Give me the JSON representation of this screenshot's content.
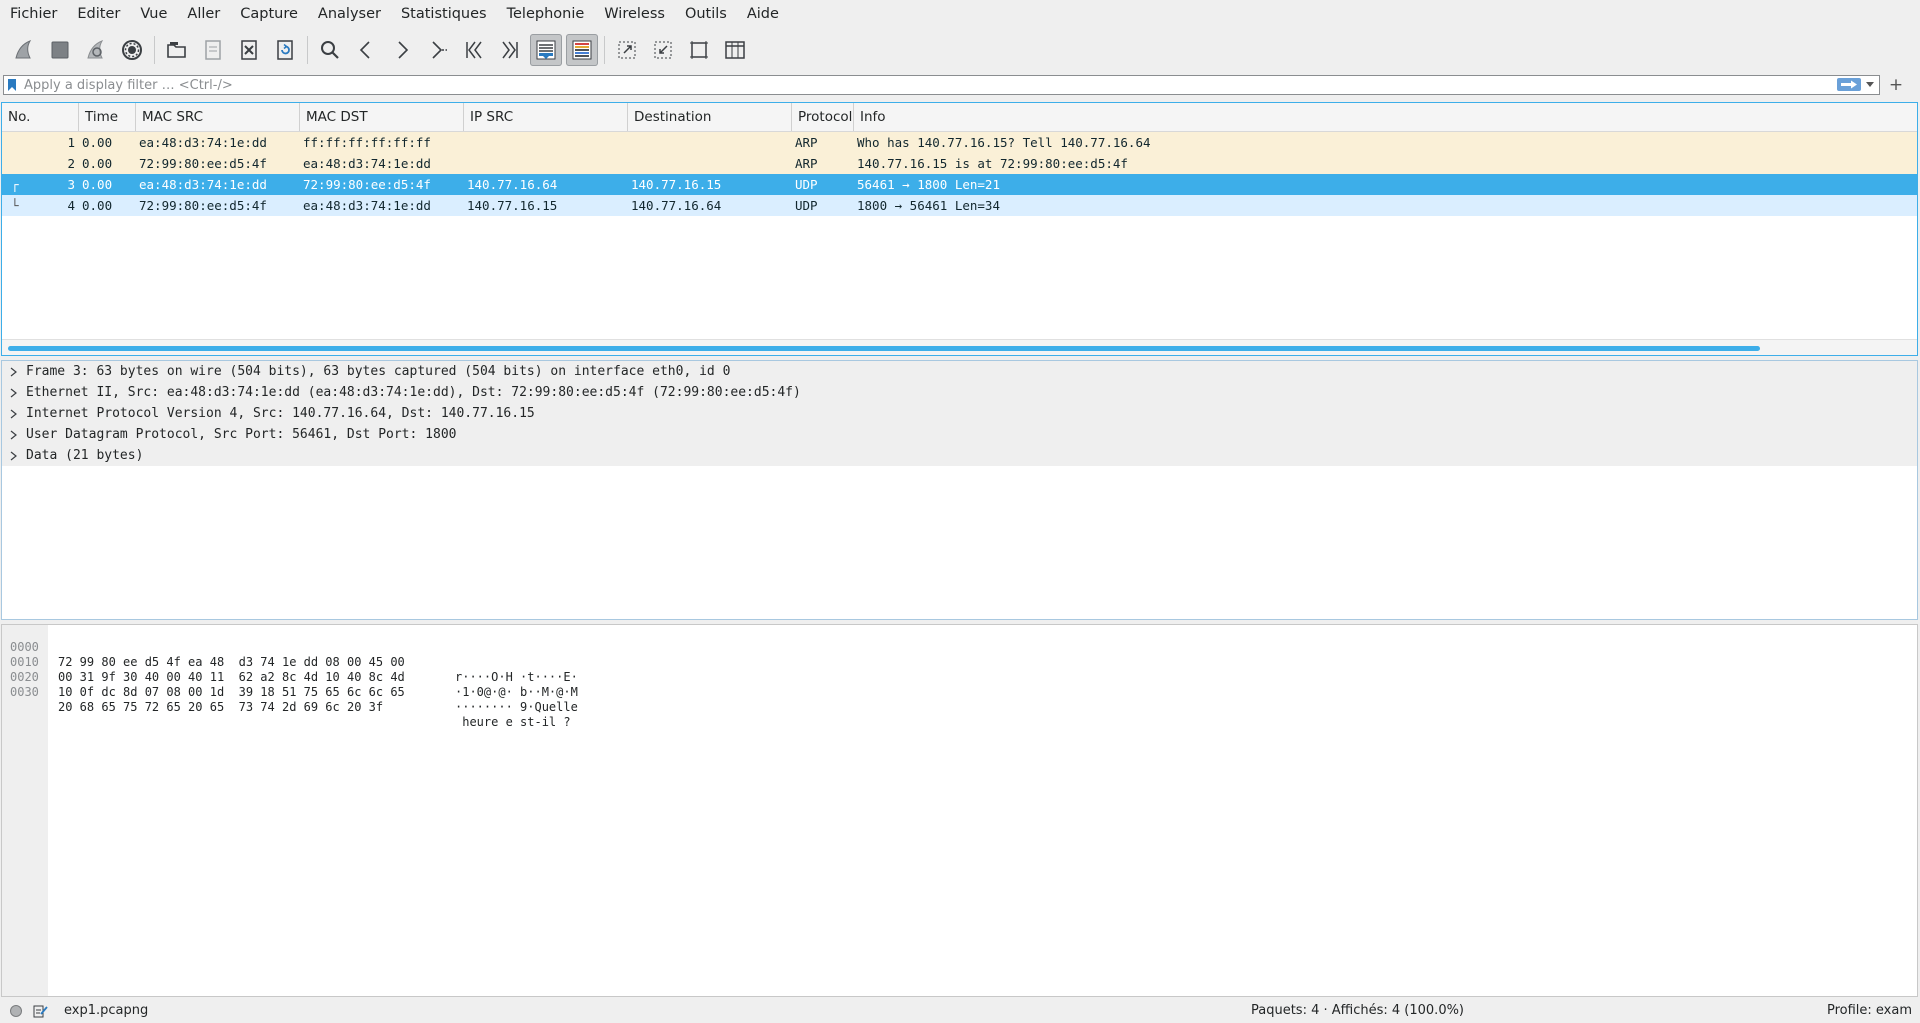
{
  "menu": [
    "Fichier",
    "Editer",
    "Vue",
    "Aller",
    "Capture",
    "Analyser",
    "Statistiques",
    "Telephonie",
    "Wireless",
    "Outils",
    "Aide"
  ],
  "toolbar": {
    "icons": [
      "shark-fin-start-icon",
      "stop-icon",
      "restart-icon",
      "capture-options-icon",
      "open-folder-icon",
      "save-icon",
      "close-file-icon",
      "reload-icon",
      "find-icon",
      "go-back-icon",
      "go-forward-icon",
      "go-to-packet-icon",
      "first-packet-icon",
      "last-packet-icon",
      "autoscroll-icon",
      "colorize-icon",
      "zoom-in-icon",
      "zoom-out-icon",
      "normal-size-icon",
      "resize-columns-icon"
    ]
  },
  "filter": {
    "placeholder": "Apply a display filter … <Ctrl-/>",
    "value": "",
    "add_label": "+"
  },
  "packet_list": {
    "columns": [
      "No.",
      "Time",
      "MAC SRC",
      "MAC DST",
      "IP SRC",
      "Destination",
      "Protocol",
      "Info"
    ],
    "rows": [
      {
        "no": "1",
        "time": "0.00",
        "mac_src": "ea:48:d3:74:1e:dd",
        "mac_dst": "ff:ff:ff:ff:ff:ff",
        "ip_src": "",
        "dst": "",
        "proto": "ARP",
        "info": "Who has 140.77.16.15? Tell 140.77.16.64"
      },
      {
        "no": "2",
        "time": "0.00",
        "mac_src": "72:99:80:ee:d5:4f",
        "mac_dst": "ea:48:d3:74:1e:dd",
        "ip_src": "",
        "dst": "",
        "proto": "ARP",
        "info": "140.77.16.15 is at 72:99:80:ee:d5:4f"
      },
      {
        "no": "3",
        "time": "0.00",
        "mac_src": "ea:48:d3:74:1e:dd",
        "mac_dst": "72:99:80:ee:d5:4f",
        "ip_src": "140.77.16.64",
        "dst": "140.77.16.15",
        "proto": "UDP",
        "info": "56461 → 1800 Len=21"
      },
      {
        "no": "4",
        "time": "0.00",
        "mac_src": "72:99:80:ee:d5:4f",
        "mac_dst": "ea:48:d3:74:1e:dd",
        "ip_src": "140.77.16.15",
        "dst": "140.77.16.64",
        "proto": "UDP",
        "info": "1800 → 56461 Len=34"
      }
    ],
    "selected_row": "3"
  },
  "details": [
    "Frame 3: 63 bytes on wire (504 bits), 63 bytes captured (504 bits) on interface eth0, id 0",
    "Ethernet II, Src: ea:48:d3:74:1e:dd (ea:48:d3:74:1e:dd), Dst: 72:99:80:ee:d5:4f (72:99:80:ee:d5:4f)",
    "Internet Protocol Version 4, Src: 140.77.16.64, Dst: 140.77.16.15",
    "User Datagram Protocol, Src Port: 56461, Dst Port: 1800",
    "Data (21 bytes)"
  ],
  "bytes": [
    {
      "offset": "0000",
      "hex": "72 99 80 ee d5 4f ea 48  d3 74 1e dd 08 00 45 00",
      "ascii": "r····O·H ·t····E·"
    },
    {
      "offset": "0010",
      "hex": "00 31 9f 30 40 00 40 11  62 a2 8c 4d 10 40 8c 4d",
      "ascii": "·1·0@·@· b··M·@·M"
    },
    {
      "offset": "0020",
      "hex": "10 0f dc 8d 07 08 00 1d  39 18 51 75 65 6c 6c 65",
      "ascii": "········ 9·Quelle"
    },
    {
      "offset": "0030",
      "hex": "20 68 65 75 72 65 20 65  73 74 2d 69 6c 20 3f",
      "ascii": " heure e st-il ?"
    }
  ],
  "status": {
    "file": "exp1.pcapng",
    "packets": "Paquets: 4 · Affichés: 4 (100.0%)",
    "profile": "Profile: exam"
  },
  "colors": {
    "accent": "#3daee9",
    "arp_row": "#faf0d7",
    "udp_row": "#daeeff"
  }
}
